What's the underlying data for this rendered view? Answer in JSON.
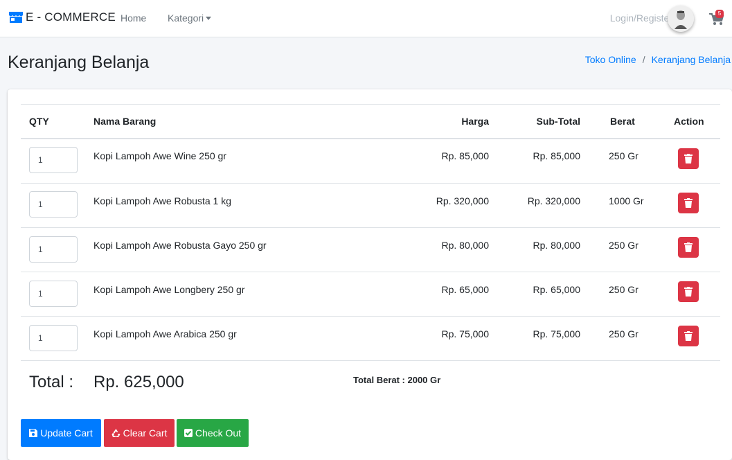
{
  "navbar": {
    "brand": "E - COMMERCE",
    "home": "Home",
    "kategori": "Kategori",
    "login": "Login/Register",
    "cart_count": "5"
  },
  "header": {
    "title": "Keranjang Belanja",
    "breadcrumb": [
      "Toko Online",
      "Keranjang Belanja"
    ]
  },
  "table": {
    "columns": [
      "QTY",
      "Nama Barang",
      "Harga",
      "Sub-Total",
      "Berat",
      "Action"
    ],
    "rows": [
      {
        "qty": "1",
        "name": "Kopi Lampoh Awe Wine 250 gr",
        "price": "Rp. 85,000",
        "subtotal": "Rp. 85,000",
        "weight": "250 Gr"
      },
      {
        "qty": "1",
        "name": "Kopi Lampoh Awe Robusta 1 kg",
        "price": "Rp. 320,000",
        "subtotal": "Rp. 320,000",
        "weight": "1000 Gr"
      },
      {
        "qty": "1",
        "name": "Kopi Lampoh Awe Robusta Gayo 250 gr",
        "price": "Rp. 80,000",
        "subtotal": "Rp. 80,000",
        "weight": "250 Gr"
      },
      {
        "qty": "1",
        "name": "Kopi Lampoh Awe Longbery 250 gr",
        "price": "Rp. 65,000",
        "subtotal": "Rp. 65,000",
        "weight": "250 Gr"
      },
      {
        "qty": "1",
        "name": "Kopi Lampoh Awe Arabica 250 gr",
        "price": "Rp. 75,000",
        "subtotal": "Rp. 75,000",
        "weight": "250 Gr"
      }
    ]
  },
  "summary": {
    "total_label": "Total :",
    "total_value": "Rp. 625,000",
    "total_berat": "Total Berat : 2000 Gr"
  },
  "actions": {
    "update": "Update Cart",
    "clear": "Clear Cart",
    "checkout": "Check Out"
  },
  "colors": {
    "primary": "#007bff",
    "danger": "#dc3545",
    "success": "#28a745"
  },
  "icons": {
    "brand": "store-icon",
    "cart": "shopping-cart-icon",
    "delete": "trash-icon",
    "update": "save-icon",
    "clear": "recycle-icon",
    "checkout": "check-square-icon"
  }
}
